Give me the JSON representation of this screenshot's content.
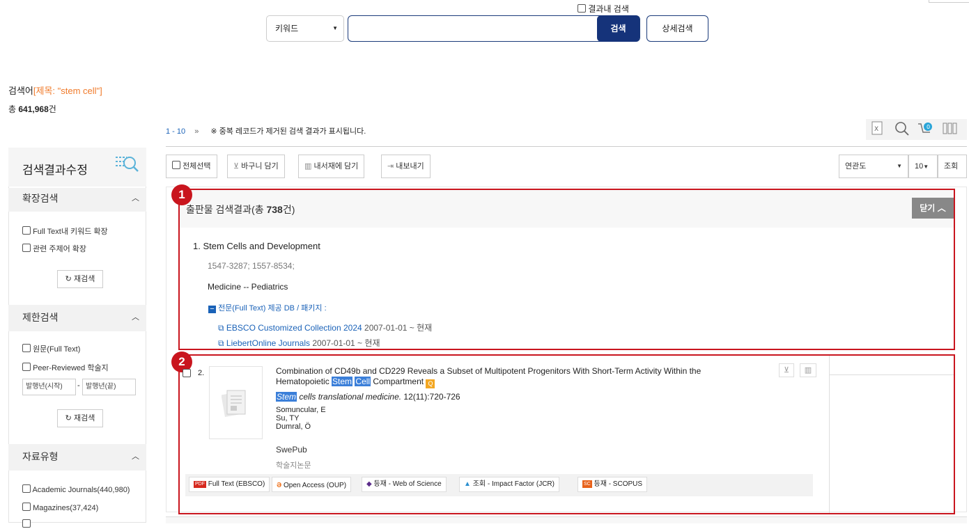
{
  "search": {
    "within_results_label": "결과내 검색",
    "field_select": "키워드",
    "input_value": "",
    "search_button": "검색",
    "advanced_button": "상세검색"
  },
  "summary": {
    "query_prefix": "검색어",
    "query_value": "[제목: \"stem cell\"]",
    "total_prefix": "총 ",
    "total_count": "641,968",
    "total_suffix": "건"
  },
  "paging": {
    "range": "1 - 10",
    "next": "»",
    "notice": "※ 중복 레코드가 제거된 검색 결과가 표시됩니다."
  },
  "sidebar": {
    "title": "검색결과수정",
    "expand": {
      "title": "확장검색",
      "options": [
        "Full Text내 키워드 확장",
        "관련 주제어 확장"
      ],
      "research": "재검색"
    },
    "limit": {
      "title": "제한검색",
      "options": [
        "원문(Full Text)",
        "Peer-Reviewed 학술지"
      ],
      "year_from": "발행년(시작)",
      "year_to": "발행년(끝)",
      "sep": "-",
      "research": "재검색"
    },
    "types": {
      "title": "자료유형",
      "options": [
        "Academic Journals(440,980)",
        "Magazines(37,424)"
      ]
    }
  },
  "toolbar": {
    "select_all": "전체선택",
    "cart": "바구니 담기",
    "library": "내서재에 담기",
    "export": "내보내기",
    "sort": "연관도",
    "per_page": "10",
    "view": "조회"
  },
  "pub_box": {
    "marker": "1",
    "heading_prefix": "출판물 검색결과(총 ",
    "heading_count": "738",
    "heading_suffix": "건)",
    "close": "닫기",
    "item_title": "1. Stem Cells and Development",
    "issn": "1547-3287; 1557-8534;",
    "subject": "Medicine -- Pediatrics",
    "fulltext_label": "전문(Full Text) 제공 DB / 패키지 :",
    "dbs": [
      {
        "name": "EBSCO Customized Collection 2024",
        "range": "2007-01-01 ~ 현재"
      },
      {
        "name": "LiebertOnline Journals",
        "range": "2007-01-01 ~ 현재"
      }
    ]
  },
  "result": {
    "marker": "2",
    "number": "2.",
    "title_line1": "Combination of CD49b and CD229 Reveals a Subset of Multipotent Progenitors With Short-Term Activity Within the",
    "title_line2_prefix": "Hematopoietic ",
    "title_hl1": "Stem",
    "title_hl2": "Cell",
    "title_line2_suffix": " Compartment",
    "journal_hl": "Stem",
    "journal_rest": " cells translational medicine.",
    "citation": " 12(11):720-726",
    "authors": [
      "Somuncular, E",
      "Su, TY",
      "Dumral, Ö"
    ],
    "source": "SwePub",
    "doc_type": "학술지논문",
    "badges": [
      {
        "icon": "PDF",
        "label": "Full Text (EBSCO)"
      },
      {
        "icon": "ə",
        "label": "Open Access (OUP)"
      },
      {
        "icon": "◆",
        "label": "등재 - Web of Science"
      },
      {
        "icon": "▲",
        "label": "조회 - Impact Factor (JCR)"
      },
      {
        "icon": "SC",
        "label": "등재 - SCOPUS"
      }
    ]
  },
  "colors": {
    "accent": "#f07a2a",
    "navy": "#15337a",
    "marker_red": "#c9151e",
    "highlight": "#3b7fd9"
  }
}
